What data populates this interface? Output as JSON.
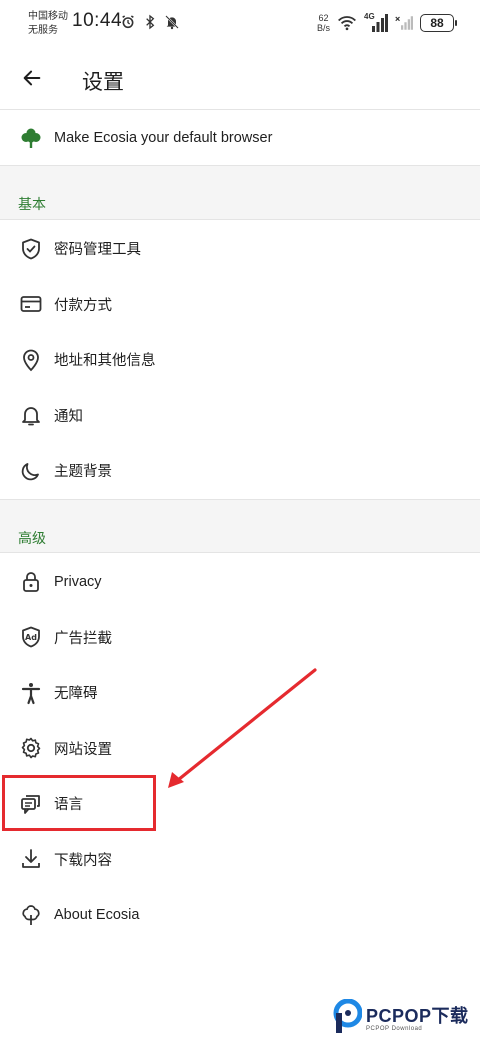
{
  "status_bar": {
    "carrier_line1": "中国移动",
    "carrier_line2": "无服务",
    "time": "10:44",
    "net_speed_value": "62",
    "net_speed_unit": "B/s",
    "network_type": "4G",
    "battery": "88"
  },
  "app_bar": {
    "title": "设置"
  },
  "default_browser": {
    "label": "Make Ecosia your default browser"
  },
  "sections": [
    {
      "header": "基本",
      "items": [
        {
          "label": "密码管理工具",
          "icon": "shield-check-icon"
        },
        {
          "label": "付款方式",
          "icon": "credit-card-icon"
        },
        {
          "label": "地址和其他信息",
          "icon": "location-pin-icon"
        },
        {
          "label": "通知",
          "icon": "bell-icon"
        },
        {
          "label": "主题背景",
          "icon": "moon-icon"
        }
      ]
    },
    {
      "header": "高级",
      "items": [
        {
          "label": "Privacy",
          "icon": "lock-icon"
        },
        {
          "label": "广告拦截",
          "icon": "ad-block-icon"
        },
        {
          "label": "无障碍",
          "icon": "accessibility-icon"
        },
        {
          "label": "网站设置",
          "icon": "gear-icon"
        },
        {
          "label": "语言",
          "icon": "language-icon"
        },
        {
          "label": "下载内容",
          "icon": "download-icon"
        },
        {
          "label": "About Ecosia",
          "icon": "tree-icon"
        }
      ]
    }
  ],
  "watermark": {
    "title": "PCPOP下载",
    "subtitle": "PCPOP Download"
  },
  "colors": {
    "accent_green": "#2e7d32",
    "annotation_red": "#e52a2f",
    "divider": "#e4e4e4",
    "section_bg": "#f5f5f5"
  }
}
